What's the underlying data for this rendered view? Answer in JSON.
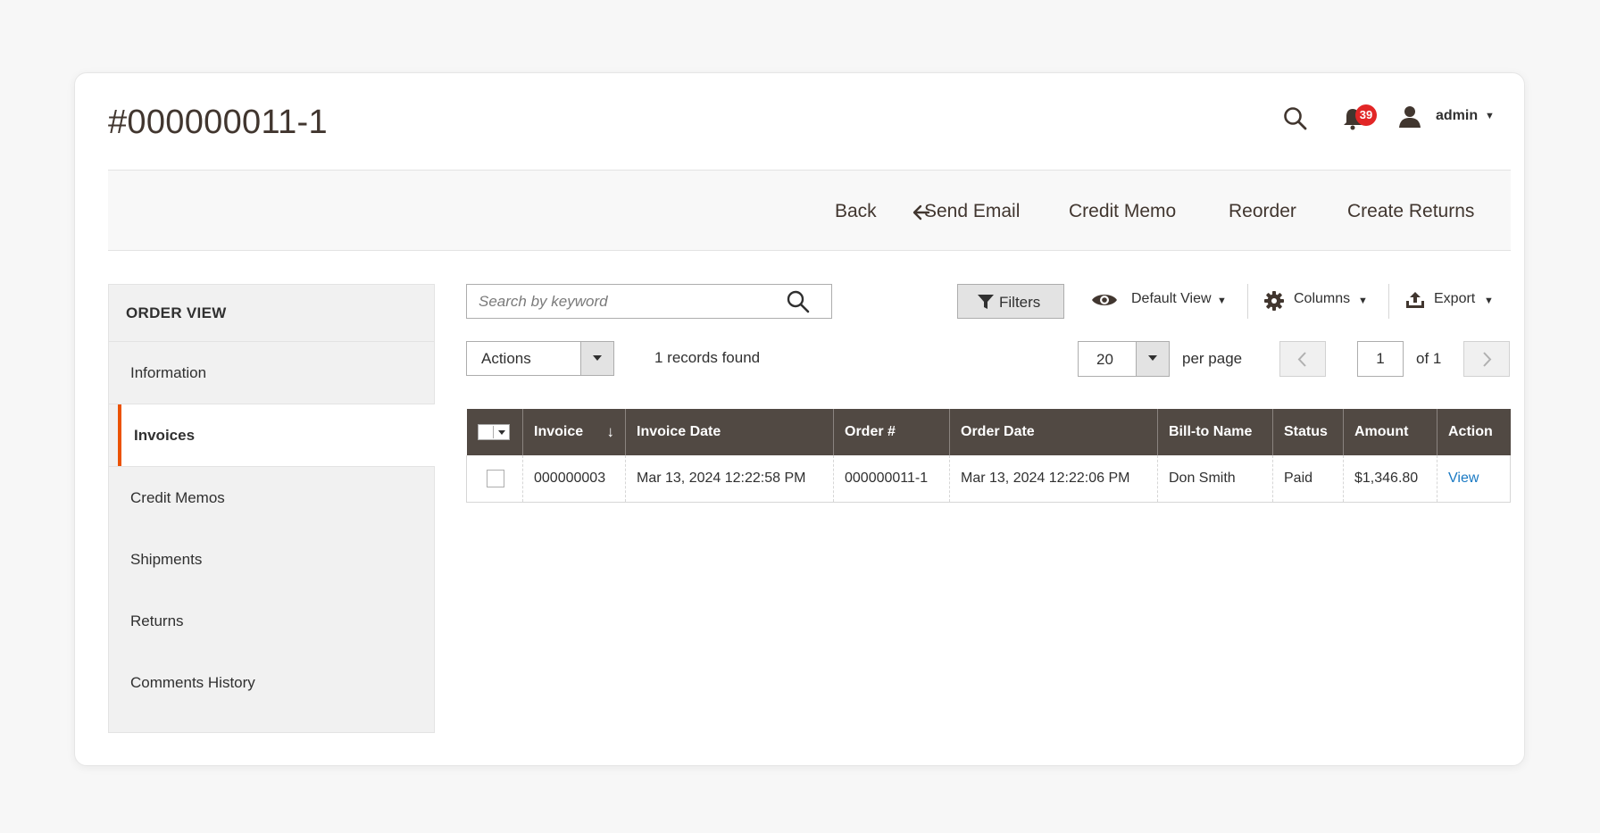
{
  "header": {
    "title": "#000000011-1",
    "notifications_count": "39",
    "user_name": "admin"
  },
  "action_bar": {
    "back": "Back",
    "send_email": "Send Email",
    "credit_memo": "Credit Memo",
    "reorder": "Reorder",
    "create_returns": "Create Returns"
  },
  "sidebar": {
    "title": "ORDER VIEW",
    "items": [
      {
        "label": "Information",
        "active": false
      },
      {
        "label": "Invoices",
        "active": true
      },
      {
        "label": "Credit Memos",
        "active": false
      },
      {
        "label": "Shipments",
        "active": false
      },
      {
        "label": "Returns",
        "active": false
      },
      {
        "label": "Comments History",
        "active": false
      }
    ]
  },
  "toolbar": {
    "search_placeholder": "Search by keyword",
    "filters": "Filters",
    "default_view": "Default View",
    "columns": "Columns",
    "export": "Export",
    "actions": "Actions",
    "records_found": "1 records found",
    "per_page_value": "20",
    "per_page_label": "per page",
    "current_page": "1",
    "of_pages": "of 1"
  },
  "grid": {
    "columns": [
      "Invoice",
      "Invoice Date",
      "Order #",
      "Order Date",
      "Bill-to Name",
      "Status",
      "Amount",
      "Action"
    ],
    "sort_indicator": "↓",
    "rows": [
      {
        "invoice": "000000003",
        "invoice_date": "Mar 13, 2024 12:22:58 PM",
        "order": "000000011-1",
        "order_date": "Mar 13, 2024 12:22:06 PM",
        "bill_to_name": "Don Smith",
        "status": "Paid",
        "amount": "$1,346.80",
        "action": "View"
      }
    ]
  },
  "colors": {
    "accent": "#eb5202",
    "grid_header": "#514943",
    "link": "#1979c3",
    "badge": "#e22626"
  }
}
